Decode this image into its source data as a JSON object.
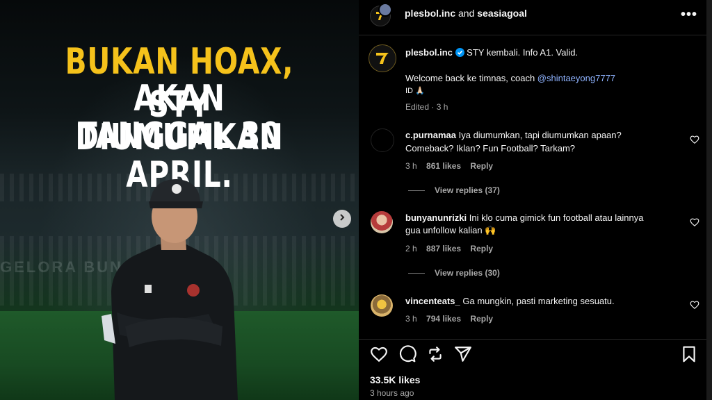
{
  "image": {
    "headline_line1_yellow": "BUKAN HOAX,",
    "headline_line1_white": " STY",
    "headline_line2": "AKAN DIUMUMKAN",
    "headline_line3": "TANGGAL 30 APRIL.",
    "stadium_sign_text": "GELORA        BUNG KA"
  },
  "header": {
    "account1": "plesbol.inc",
    "and_text": "and",
    "account2": "seasiagoal"
  },
  "caption": {
    "username": "plesbol.inc",
    "text": "STY kembali. Info A1. Valid.",
    "line2": "Welcome back ke timnas, coach ",
    "mention": "@shintaeyong7777",
    "line3": "ID 🙏🏻",
    "meta": "Edited · 3 h"
  },
  "comments": [
    {
      "username": "c.purnamaa",
      "text_line1": "Iya diumumkan, tapi diumumkan apaan?",
      "text_line2": "Comeback? Iklan? Fun Football? Tarkam?",
      "time": "3 h",
      "likes": "861 likes",
      "reply": "Reply",
      "view_replies": "View replies (37)"
    },
    {
      "username": "bunyanunrizki",
      "text_line1": "Ini klo cuma gimick fun football atau lainnya",
      "text_line2": "gua unfollow kalian 🙌",
      "time": "2 h",
      "likes": "887 likes",
      "reply": "Reply",
      "view_replies": "View replies (30)"
    },
    {
      "username": "vincenteats_",
      "text_line1": "Ga mungkin, pasti marketing sesuatu.",
      "time": "3 h",
      "likes": "794 likes",
      "reply": "Reply"
    }
  ],
  "footer": {
    "likes": "33.5K likes",
    "time": "3 hours ago"
  },
  "colors": {
    "accent_yellow": "#f5c21b",
    "verified_blue": "#0095f6",
    "mention": "#8fb3ff",
    "background": "#000000"
  },
  "icons": [
    "chevron-right-icon",
    "more-options-icon",
    "verified-icon",
    "heart-icon",
    "comment-icon",
    "repost-icon",
    "share-icon",
    "bookmark-icon"
  ]
}
